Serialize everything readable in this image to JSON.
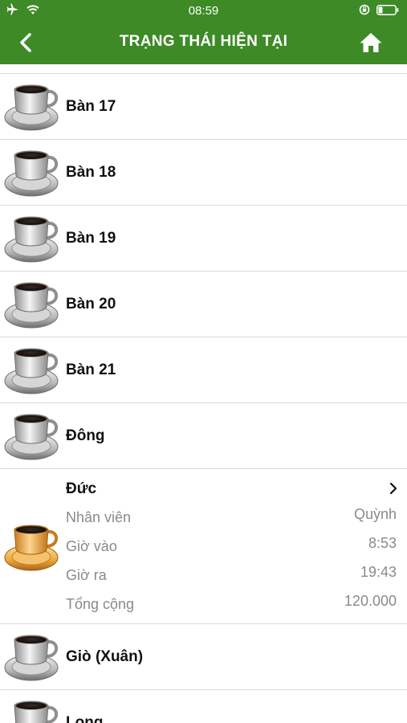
{
  "status_bar": {
    "time": "08:59",
    "icons": [
      "airplane-icon",
      "wifi-icon",
      "rotation-lock-icon",
      "battery-icon"
    ]
  },
  "nav": {
    "title": "TRẠNG THÁI HIỆN TẠI",
    "back_icon": "chevron-left-icon",
    "home_icon": "home-icon",
    "bar_color": "#3d8a26"
  },
  "tables": [
    {
      "name": "Bàn 17",
      "status": "idle"
    },
    {
      "name": "Bàn 18",
      "status": "idle"
    },
    {
      "name": "Bàn 19",
      "status": "idle"
    },
    {
      "name": "Bàn 20",
      "status": "idle"
    },
    {
      "name": "Bàn 21",
      "status": "idle"
    },
    {
      "name": "Đông",
      "status": "idle"
    },
    {
      "name": "Đức",
      "status": "active",
      "details": [
        {
          "label": "Nhân viên",
          "value": "Quỳnh"
        },
        {
          "label": "Giờ vào",
          "value": "8:53"
        },
        {
          "label": "Giờ ra",
          "value": "19:43"
        },
        {
          "label": "Tổng cộng",
          "value": "120.000"
        }
      ]
    },
    {
      "name": "Giò (Xuân)",
      "status": "idle"
    },
    {
      "name": "Long",
      "status": "idle"
    }
  ],
  "colors": {
    "idle_cup": "#9a9a9a",
    "active_cup": "#e8a33a"
  }
}
